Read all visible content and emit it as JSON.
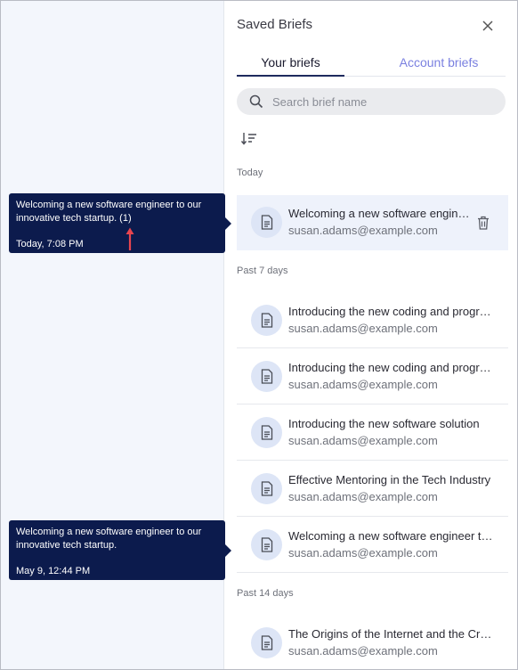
{
  "panel": {
    "title": "Saved Briefs",
    "tabs": [
      {
        "label": "Your briefs",
        "active": true
      },
      {
        "label": "Account briefs",
        "active": false
      }
    ],
    "search_placeholder": "Search brief name"
  },
  "sections": [
    {
      "label": "Today"
    },
    {
      "label": "Past 7 days"
    },
    {
      "label": "Past 14 days"
    }
  ],
  "items": [
    {
      "title": "Welcoming a new software engineer to our innovative tech startup. (1)",
      "email": "susan.adams@example.com",
      "selected": true
    },
    {
      "title": "Introducing the new coding and programming",
      "email": "susan.adams@example.com"
    },
    {
      "title": "Introducing the new coding and programming",
      "email": "susan.adams@example.com"
    },
    {
      "title": "Introducing the new software solution",
      "email": "susan.adams@example.com"
    },
    {
      "title": "Effective Mentoring in the Tech Industry",
      "email": "susan.adams@example.com"
    },
    {
      "title": "Welcoming a new software engineer to our innovative tech startup.",
      "email": "susan.adams@example.com"
    },
    {
      "title": "The Origins of the Internet and the Creation",
      "email": "susan.adams@example.com"
    }
  ],
  "tooltips": [
    {
      "title": "Welcoming a new software engineer to our innovative tech startup. (1)",
      "time": "Today, 7:08 PM"
    },
    {
      "title": "Welcoming a new software engineer to our innovative tech startup.",
      "time": "May 9, 12:44 PM"
    }
  ],
  "colors": {
    "tooltip_bg": "#0c1b4d",
    "accent": "#7a80e0",
    "selected_row": "#eef2fb",
    "annotation_arrow": "#e8454f"
  }
}
